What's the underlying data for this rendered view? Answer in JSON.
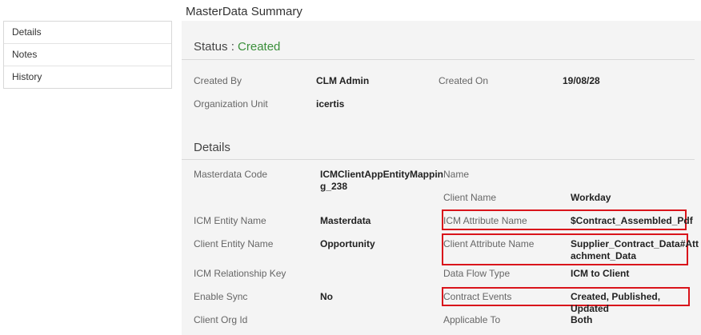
{
  "page_title": "MasterData Summary",
  "sidebar": {
    "items": [
      {
        "label": "Details"
      },
      {
        "label": "Notes"
      },
      {
        "label": "History"
      }
    ]
  },
  "status": {
    "label": "Status : ",
    "value": "Created"
  },
  "overview": {
    "created_by_label": "Created By",
    "created_by_value": "CLM Admin",
    "created_on_label": "Created On",
    "created_on_value": "19/08/28",
    "org_unit_label": "Organization Unit",
    "org_unit_value": "icertis"
  },
  "details": {
    "title": "Details",
    "masterdata_code_label": "Masterdata Code",
    "masterdata_code_value_line1": "ICMClientAppEntityMappin",
    "masterdata_code_value_line2": "g_238",
    "name_label": "Name",
    "client_name_label": "Client Name",
    "client_name_value": "Workday",
    "icm_entity_name_label": "ICM Entity Name",
    "icm_entity_name_value": "Masterdata",
    "icm_attribute_name_label": "ICM Attribute Name",
    "icm_attribute_name_value": "$Contract_Assembled_Pdf",
    "client_entity_name_label": "Client Entity Name",
    "client_entity_name_value": "Opportunity",
    "client_attribute_name_label": "Client Attribute Name",
    "client_attribute_name_value_line1": "Supplier_Contract_Data#Att",
    "client_attribute_name_value_line2": "achment_Data",
    "icm_relationship_key_label": "ICM Relationship Key",
    "data_flow_type_label": "Data Flow Type",
    "data_flow_type_value": "ICM to Client",
    "enable_sync_label": "Enable Sync",
    "enable_sync_value": "No",
    "contract_events_label": "Contract Events",
    "contract_events_value": "Created, Published, Updated",
    "client_org_id_label": "Client Org Id",
    "applicable_to_label": "Applicable To",
    "applicable_to_value": "Both"
  },
  "highlight_color": "#d9141b",
  "status_color": "#3a8f3a"
}
